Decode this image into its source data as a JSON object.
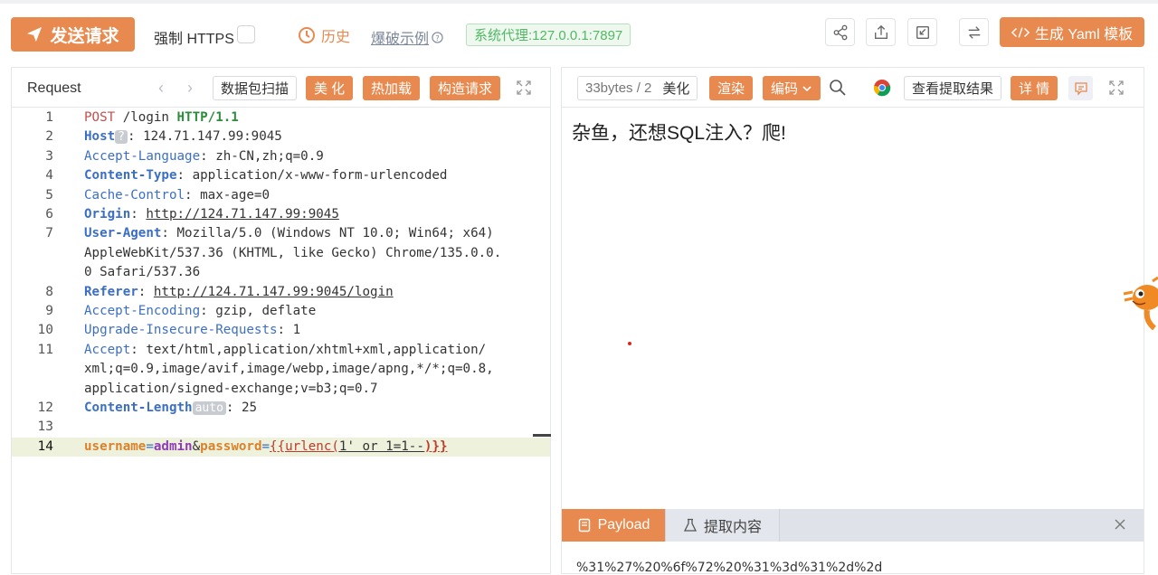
{
  "toolbar": {
    "send_label": "发送请求",
    "https_label": "强制 HTTPS",
    "history_label": "历史",
    "brute_label": "爆破示例",
    "proxy_label": "系统代理:127.0.0.1:7897",
    "yaml_label": "生成 Yaml 模板",
    "accent_color": "#e88a4f"
  },
  "request": {
    "title": "Request",
    "scan_label": "数据包扫描",
    "beautify_label": "美 化",
    "hotload_label": "热加载",
    "construct_label": "构造请求",
    "lines": [
      {
        "n": "1"
      },
      {
        "n": "2"
      },
      {
        "n": "3"
      },
      {
        "n": "4"
      },
      {
        "n": "5"
      },
      {
        "n": "6"
      },
      {
        "n": "7"
      },
      {
        "n": "8"
      },
      {
        "n": "9"
      },
      {
        "n": "10"
      },
      {
        "n": "11"
      },
      {
        "n": "12"
      },
      {
        "n": "13"
      },
      {
        "n": "14"
      }
    ],
    "l1": {
      "method": "POST",
      "path": " /login ",
      "proto": "HTTP/1.1"
    },
    "l2": {
      "key": "Host",
      "tag": "?",
      "val": ": 124.71.147.99:9045"
    },
    "l3": {
      "key": "Accept-Language",
      "val": ": zh-CN,zh;q=0.9"
    },
    "l4": {
      "key": "Content-Type",
      "val": ": application/x-www-form-urlencoded"
    },
    "l5": {
      "key": "Cache-Control",
      "val": ": max-age=0"
    },
    "l6": {
      "key": "Origin",
      "sep": ": ",
      "val": "http://124.71.147.99:9045"
    },
    "l7": {
      "key": "User-Agent",
      "val": ": Mozilla/5.0 (Windows NT 10.0; Win64; x64)",
      "cont1": "AppleWebKit/537.36 (KHTML, like Gecko) Chrome/135.0.0.",
      "cont2": "0 Safari/537.36"
    },
    "l8": {
      "key": "Referer",
      "sep": ": ",
      "val": "http://124.71.147.99:9045/login"
    },
    "l9": {
      "key": "Accept-Encoding",
      "val": ": gzip, deflate"
    },
    "l10": {
      "key": "Upgrade-Insecure-Requests",
      "val": ": 1"
    },
    "l11": {
      "key": "Accept",
      "val": ": text/html,application/xhtml+xml,application/",
      "cont1": "xml;q=0.9,image/avif,image/webp,image/apng,*/*;q=0.8,",
      "cont2": "application/signed-exchange;v=b3;q=0.7"
    },
    "l12": {
      "key": "Content-Length",
      "tag": "auto",
      "val": ": 25"
    },
    "l14": {
      "p1": "username",
      "eq1": "=",
      "v1": "admin",
      "amp": "&",
      "p2": "password",
      "eq2": "=",
      "f1": "{{urlenc(",
      "arg": "1' or 1=1--",
      "f2": ")}}"
    }
  },
  "response": {
    "status": "33bytes / 2",
    "beautify_label": "美化",
    "render_label": "渲染",
    "encode_label": "编码",
    "extract_result_label": "查看提取结果",
    "detail_label": "详 情",
    "body_text": "杂鱼，还想SQL注入？爬!",
    "tab_payload": "Payload",
    "tab_extract": "提取内容",
    "payload_text": "%31%27%20%6f%72%20%31%3d%31%2d%2d"
  }
}
